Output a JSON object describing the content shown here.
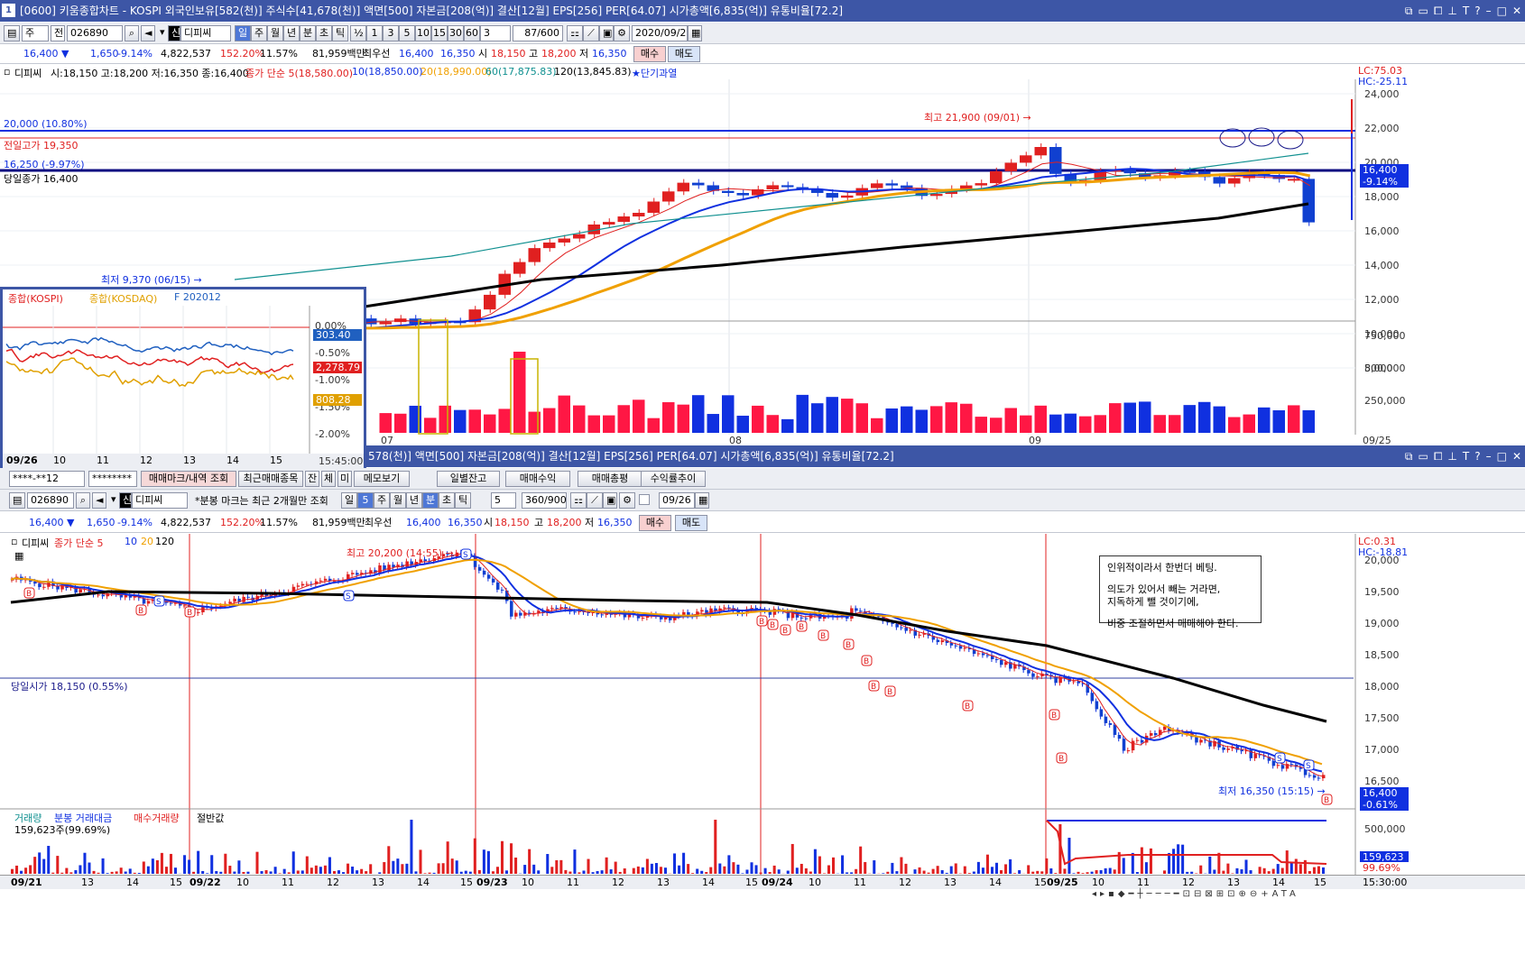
{
  "top": {
    "title": "[0600] 키움종합차트 - KOSPI 외국인보유[582(천)] 주식수[41,678(천)] 액면[500] 자본금[208(억)] 결산[12월] EPS[256] PER[64.07] 시가총액[6,835(억)] 유통비율[72.2]",
    "window_icon": "1",
    "toolbar": {
      "type": "주",
      "prev": "전",
      "code": "026890",
      "name_tag": "신",
      "name": "디피씨",
      "periods": [
        "일",
        "주",
        "월",
        "년",
        "분",
        "초",
        "틱"
      ],
      "active_period": "일",
      "half": "½",
      "nums": [
        "1",
        "3",
        "5",
        "10",
        "15",
        "30",
        "60"
      ],
      "count": "3",
      "range": "87/600",
      "date": "2020/09/25"
    },
    "quote": {
      "price": "16,400 ▼",
      "change": "1,650",
      "rate": "-9.14%",
      "volume": "4,822,537",
      "vol_rate": "152.20%",
      "turnover": "11.57%",
      "amount": "81,959백만",
      "best": "최우선",
      "ask": "16,400",
      "bid": "16,350",
      "open_label": "시",
      "open": "18,150",
      "high_label": "고",
      "high": "18,200",
      "low_label": "저",
      "low": "16,350",
      "buy": "매수",
      "sell": "매도"
    },
    "legend": {
      "name": "디피씨",
      "ohlc": "시:18,150 고:18,200 저:16,350 종:16,400",
      "ma": [
        {
          "t": "종가 단순 5(18,580.00)",
          "c": "#e02020"
        },
        {
          "t": "10(18,850.00)",
          "c": "#1030e0"
        },
        {
          "t": "20(18,990.00)",
          "c": "#f0a000"
        },
        {
          "t": "60(17,875.83)",
          "c": "#109090"
        },
        {
          "t": "120(13,845.83)",
          "c": "#000000"
        }
      ],
      "alert": "★단기과열"
    },
    "rtop": {
      "lc": "LC:75.03",
      "hc": "HC:-25.11"
    },
    "yaxis": [
      "24,000",
      "22,000",
      "20,000",
      "18,000",
      "16,000",
      "14,000",
      "12,000",
      "10,000",
      "8,000"
    ],
    "price_tag": {
      "price": "16,400",
      "rate": "-9.14%"
    },
    "vol_axis": [
      "750,000",
      "500,000",
      "250,000"
    ],
    "x_labels": [
      "07",
      "08",
      "09",
      "09/25"
    ],
    "labels": {
      "l1": "20,000 (10.80%)",
      "l2": "전일고가 19,350",
      "l3": "16,250 (-9.97%)",
      "l4": "당일종가 16,400",
      "hi": "최고 21,900 (09/01) →",
      "lo": "최저 9,370 (06/15) →"
    }
  },
  "mini": {
    "legend": [
      {
        "t": "종합(KOSPI)",
        "c": "#e02020"
      },
      {
        "t": "종합(KOSDAQ)",
        "c": "#e0a000"
      },
      {
        "t": "F 202012",
        "c": "#2060c0"
      }
    ],
    "axis": [
      "0.00%",
      "-0.50%",
      "-1.00%",
      "-1.50%",
      "-2.00%"
    ],
    "tags": [
      {
        "v": "303.40",
        "c": "#2060c0"
      },
      {
        "v": "2,278.79",
        "c": "#e02020"
      },
      {
        "v": "808.28",
        "c": "#e0a000"
      }
    ],
    "x": [
      "09/26",
      "10",
      "11",
      "12",
      "13",
      "14",
      "15"
    ],
    "time": "15:45:00"
  },
  "bottom": {
    "title": "578(천)] 액면[500] 자본금[208(억)] 결산[12월] EPS[256] PER[64.07] 시가총액[6,835(억)] 유통비율[72.2]",
    "acct": "****-**12",
    "pw": "********",
    "tabs": [
      "매매마크/내역 조회",
      "최근매매종목",
      "잔",
      "체",
      "미",
      "메모보기"
    ],
    "buttons": [
      "일별잔고",
      "매매수익",
      "매매총평",
      "수익률추이"
    ],
    "toolbar": {
      "code": "026890",
      "name_tag": "신",
      "name": "디피씨",
      "note": "*분봉 마크는 최근 2개월만 조회",
      "periods": [
        "일",
        "5",
        "주",
        "월",
        "년",
        "분",
        "초",
        "틱"
      ],
      "active": "분",
      "num": "5",
      "range": "360/900",
      "date": "09/26"
    },
    "quote": {
      "price": "16,400 ▼",
      "change": "1,650",
      "rate": "-9.14%",
      "volume": "4,822,537",
      "vol_rate": "152.20%",
      "turnover": "11.57%",
      "amount": "81,959백만",
      "best": "최우선",
      "ask": "16,400",
      "bid": "16,350",
      "open_label": "시",
      "open": "18,150",
      "high_label": "고",
      "high": "18,200",
      "low_label": "저",
      "low": "16,350",
      "buy": "매수",
      "sell": "매도"
    },
    "legend": {
      "name": "디피씨",
      "ma": [
        {
          "t": "종가 단순 5",
          "c": "#e02020"
        },
        {
          "t": "10",
          "c": "#1030e0"
        },
        {
          "t": "20",
          "c": "#f0a000"
        },
        {
          "t": "120",
          "c": "#000000"
        }
      ]
    },
    "rtop": {
      "lc": "LC:0.31",
      "hc": "HC:-18.81"
    },
    "yaxis": [
      "20,000",
      "19,500",
      "19,000",
      "18,500",
      "18,000",
      "17,500",
      "17,000",
      "16,500"
    ],
    "price_tag": {
      "price": "16,400",
      "rate": "-0.61%"
    },
    "labels": {
      "hi": "최고 20,200 (14:55) →",
      "lo": "최저 16,350 (15:15) →",
      "open": "당일시가 18,150 (0.55%)"
    },
    "memo": [
      "인위적이라서 한번더 베팅.",
      "의도가 있어서 빼는 거라면,",
      "지독하게 뺄 것이기에,",
      "비중 조절하면서 매매해야 한다."
    ],
    "vol_legend": [
      {
        "t": "거래량",
        "c": "#109090"
      },
      {
        "t": "분봉 거래대금",
        "c": "#1030e0"
      },
      {
        "t": "매수거래량",
        "c": "#e02020"
      },
      {
        "t": "절반값",
        "c": "#000000"
      }
    ],
    "vol_info": "159,623주(99.69%)",
    "vol_axis": [
      "500,000"
    ],
    "vol_tag": {
      "v": "159,623",
      "p": "99.69%"
    },
    "x_labels": [
      "09/21",
      "13",
      "14",
      "15",
      "09/22",
      "10",
      "11",
      "12",
      "13",
      "14",
      "15",
      "09/23",
      "10",
      "11",
      "12",
      "13",
      "14",
      "15",
      "09/24",
      "10",
      "11",
      "12",
      "13",
      "14",
      "15",
      "09/25",
      "10",
      "11",
      "12",
      "13",
      "14",
      "15"
    ],
    "time": "15:30:00"
  }
}
